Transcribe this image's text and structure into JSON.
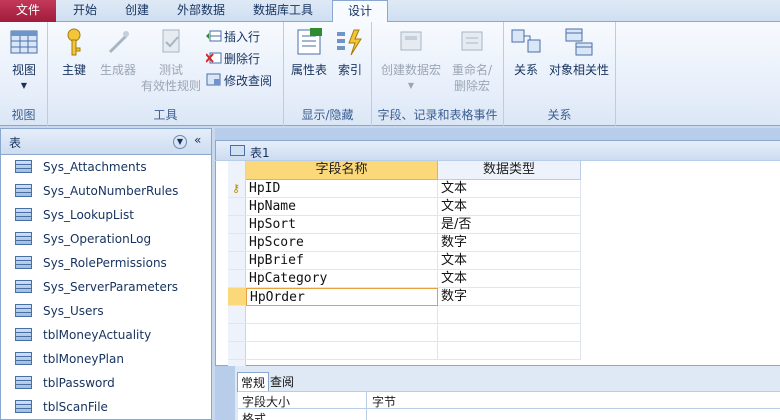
{
  "ribbon_tabs": [
    "文件",
    "开始",
    "创建",
    "外部数据",
    "数据库工具",
    "设计"
  ],
  "groups": {
    "view": {
      "label": "视图",
      "btn": "视图"
    },
    "tools": {
      "label": "工具",
      "key": "主键",
      "builder": "生成器",
      "test_line1": "测试",
      "test_line2": "有效性规则",
      "insert_row": "插入行",
      "delete_row": "删除行",
      "modify_lookup": "修改查阅"
    },
    "show_hide": {
      "label": "显示/隐藏",
      "sheet": "属性表",
      "index": "索引"
    },
    "events": {
      "label": "字段、记录和表格事件",
      "create_macro": "创建数据宏",
      "rename_line1": "重命名/",
      "rename_line2": "删除宏"
    },
    "relations": {
      "label": "关系",
      "rel": "关系",
      "deps": "对象相关性"
    }
  },
  "nav": {
    "title": "表",
    "items": [
      "Sys_Attachments",
      "Sys_AutoNumberRules",
      "Sys_LookupList",
      "Sys_OperationLog",
      "Sys_RolePermissions",
      "Sys_ServerParameters",
      "Sys_Users",
      "tblMoneyActuality",
      "tblMoneyPlan",
      "tblPassword",
      "tblScanFile"
    ]
  },
  "doc": {
    "tab_title": "表1",
    "col_name": "字段名称",
    "col_type": "数据类型",
    "rows": [
      {
        "name": "HpID",
        "type": "文本"
      },
      {
        "name": "HpName",
        "type": "文本"
      },
      {
        "name": "HpSort",
        "type": "是/否"
      },
      {
        "name": "HpScore",
        "type": "数字"
      },
      {
        "name": "HpBrief",
        "type": "文本"
      },
      {
        "name": "HpCategory",
        "type": "文本"
      },
      {
        "name": "HpOrder",
        "type": "数字"
      }
    ]
  },
  "props": {
    "tab_general": "常规",
    "tab_lookup": "查阅",
    "field_size_label": "字段大小",
    "field_size_value": "字节",
    "format_label": "格式"
  },
  "colors": {
    "accent": "#fbd97a",
    "file_tab": "#a11b3b",
    "frame": "#8aa7cf"
  }
}
